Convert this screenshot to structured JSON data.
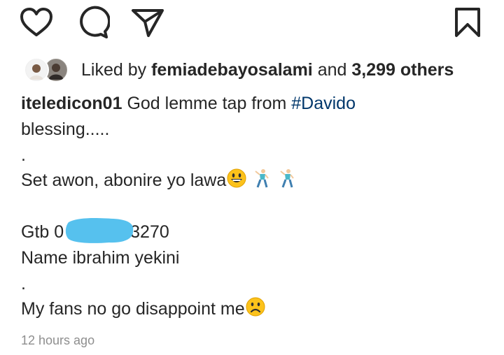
{
  "post": {
    "liked_by_prefix": "Liked by",
    "liked_by_user": "femiadebayosalami",
    "liked_by_and": "and",
    "liked_by_others": "3,299 others",
    "caption_username": "iteledicon01",
    "caption_line1_text": "God lemme tap from",
    "caption_hashtag": "#Davido",
    "caption_line2": "blessing.....",
    "caption_dot1": ".",
    "caption_line3": "Set awon, abonire yo lawa",
    "caption_gtb_prefix": "Gtb 0",
    "caption_gtb_suffix": "3270",
    "caption_name_line": "Name ibrahim yekini",
    "caption_dot2": ".",
    "caption_line_last": "My fans no go disappoint me",
    "timestamp": "12 hours ago"
  },
  "icons": {
    "like": "heart-outline-icon",
    "comment": "comment-bubble-icon",
    "share": "paper-plane-icon",
    "save": "bookmark-outline-icon"
  },
  "colors": {
    "text": "#262626",
    "hashtag": "#00376b",
    "timestamp": "#8e8e8e",
    "redaction": "#56c1ee"
  }
}
